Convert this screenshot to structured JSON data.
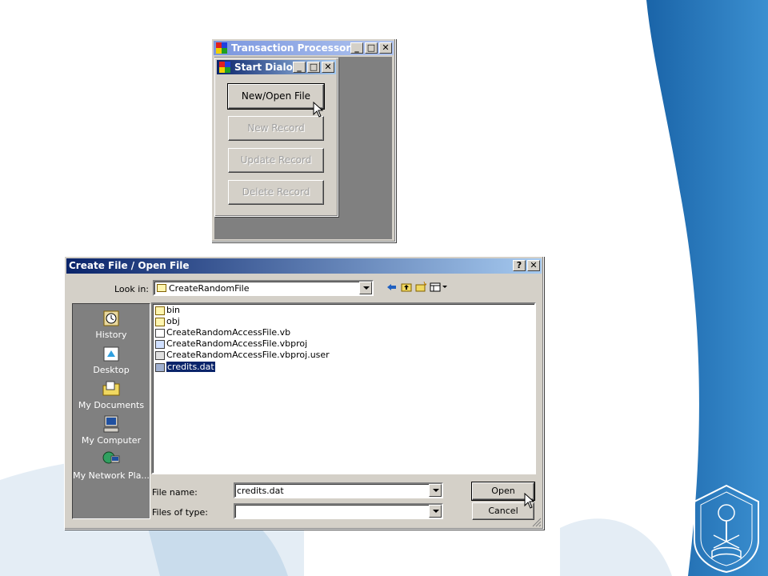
{
  "transaction_window": {
    "title": "Transaction Processor"
  },
  "start_dialog": {
    "title": "Start Dialog",
    "buttons": [
      {
        "label": "New/Open File",
        "enabled": true
      },
      {
        "label": "New Record",
        "enabled": false
      },
      {
        "label": "Update Record",
        "enabled": false
      },
      {
        "label": "Delete Record",
        "enabled": false
      }
    ]
  },
  "file_dialog": {
    "title": "Create File / Open File",
    "look_in_label": "Look in:",
    "look_in_value": "CreateRandomFile",
    "places": [
      {
        "label": "History",
        "icon": "history-icon"
      },
      {
        "label": "Desktop",
        "icon": "desktop-icon"
      },
      {
        "label": "My Documents",
        "icon": "my-documents-icon"
      },
      {
        "label": "My Computer",
        "icon": "my-computer-icon"
      },
      {
        "label": "My Network Pla...",
        "icon": "network-places-icon"
      }
    ],
    "files": [
      {
        "name": "bin",
        "type": "folder"
      },
      {
        "name": "obj",
        "type": "folder"
      },
      {
        "name": "CreateRandomAccessFile.vb",
        "type": "file"
      },
      {
        "name": "CreateRandomAccessFile.vbproj",
        "type": "file"
      },
      {
        "name": "CreateRandomAccessFile.vbproj.user",
        "type": "file"
      },
      {
        "name": "credits.dat",
        "type": "file",
        "selected": true
      }
    ],
    "file_name_label": "File name:",
    "file_name_value": "credits.dat",
    "files_of_type_label": "Files of type:",
    "files_of_type_value": "",
    "open_label": "Open",
    "cancel_label": "Cancel"
  },
  "colors": {
    "title_active": "#0a246a",
    "title_gradient_end": "#a6caf0",
    "face": "#d4d0c8",
    "slide_blue": "#1f6fb2"
  }
}
